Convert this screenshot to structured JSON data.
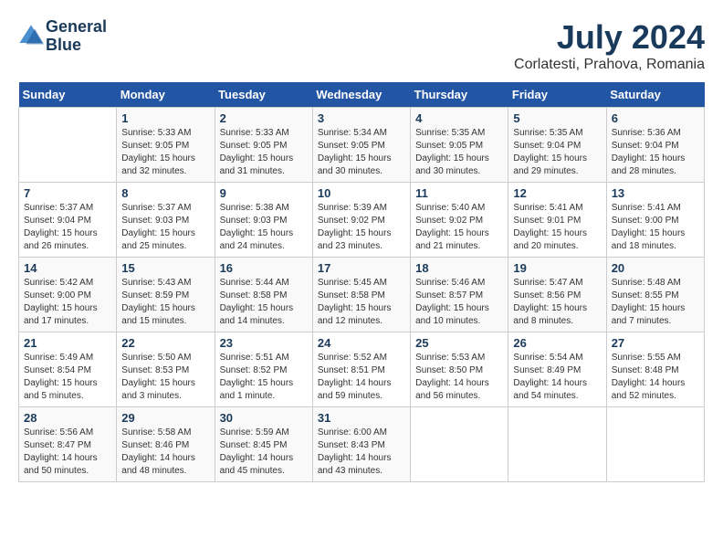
{
  "logo": {
    "line1": "General",
    "line2": "Blue"
  },
  "title": {
    "month_year": "July 2024",
    "location": "Corlatesti, Prahova, Romania"
  },
  "days_of_week": [
    "Sunday",
    "Monday",
    "Tuesday",
    "Wednesday",
    "Thursday",
    "Friday",
    "Saturday"
  ],
  "weeks": [
    [
      {
        "day": "",
        "info": ""
      },
      {
        "day": "1",
        "info": "Sunrise: 5:33 AM\nSunset: 9:05 PM\nDaylight: 15 hours\nand 32 minutes."
      },
      {
        "day": "2",
        "info": "Sunrise: 5:33 AM\nSunset: 9:05 PM\nDaylight: 15 hours\nand 31 minutes."
      },
      {
        "day": "3",
        "info": "Sunrise: 5:34 AM\nSunset: 9:05 PM\nDaylight: 15 hours\nand 30 minutes."
      },
      {
        "day": "4",
        "info": "Sunrise: 5:35 AM\nSunset: 9:05 PM\nDaylight: 15 hours\nand 30 minutes."
      },
      {
        "day": "5",
        "info": "Sunrise: 5:35 AM\nSunset: 9:04 PM\nDaylight: 15 hours\nand 29 minutes."
      },
      {
        "day": "6",
        "info": "Sunrise: 5:36 AM\nSunset: 9:04 PM\nDaylight: 15 hours\nand 28 minutes."
      }
    ],
    [
      {
        "day": "7",
        "info": "Sunrise: 5:37 AM\nSunset: 9:04 PM\nDaylight: 15 hours\nand 26 minutes."
      },
      {
        "day": "8",
        "info": "Sunrise: 5:37 AM\nSunset: 9:03 PM\nDaylight: 15 hours\nand 25 minutes."
      },
      {
        "day": "9",
        "info": "Sunrise: 5:38 AM\nSunset: 9:03 PM\nDaylight: 15 hours\nand 24 minutes."
      },
      {
        "day": "10",
        "info": "Sunrise: 5:39 AM\nSunset: 9:02 PM\nDaylight: 15 hours\nand 23 minutes."
      },
      {
        "day": "11",
        "info": "Sunrise: 5:40 AM\nSunset: 9:02 PM\nDaylight: 15 hours\nand 21 minutes."
      },
      {
        "day": "12",
        "info": "Sunrise: 5:41 AM\nSunset: 9:01 PM\nDaylight: 15 hours\nand 20 minutes."
      },
      {
        "day": "13",
        "info": "Sunrise: 5:41 AM\nSunset: 9:00 PM\nDaylight: 15 hours\nand 18 minutes."
      }
    ],
    [
      {
        "day": "14",
        "info": "Sunrise: 5:42 AM\nSunset: 9:00 PM\nDaylight: 15 hours\nand 17 minutes."
      },
      {
        "day": "15",
        "info": "Sunrise: 5:43 AM\nSunset: 8:59 PM\nDaylight: 15 hours\nand 15 minutes."
      },
      {
        "day": "16",
        "info": "Sunrise: 5:44 AM\nSunset: 8:58 PM\nDaylight: 15 hours\nand 14 minutes."
      },
      {
        "day": "17",
        "info": "Sunrise: 5:45 AM\nSunset: 8:58 PM\nDaylight: 15 hours\nand 12 minutes."
      },
      {
        "day": "18",
        "info": "Sunrise: 5:46 AM\nSunset: 8:57 PM\nDaylight: 15 hours\nand 10 minutes."
      },
      {
        "day": "19",
        "info": "Sunrise: 5:47 AM\nSunset: 8:56 PM\nDaylight: 15 hours\nand 8 minutes."
      },
      {
        "day": "20",
        "info": "Sunrise: 5:48 AM\nSunset: 8:55 PM\nDaylight: 15 hours\nand 7 minutes."
      }
    ],
    [
      {
        "day": "21",
        "info": "Sunrise: 5:49 AM\nSunset: 8:54 PM\nDaylight: 15 hours\nand 5 minutes."
      },
      {
        "day": "22",
        "info": "Sunrise: 5:50 AM\nSunset: 8:53 PM\nDaylight: 15 hours\nand 3 minutes."
      },
      {
        "day": "23",
        "info": "Sunrise: 5:51 AM\nSunset: 8:52 PM\nDaylight: 15 hours\nand 1 minute."
      },
      {
        "day": "24",
        "info": "Sunrise: 5:52 AM\nSunset: 8:51 PM\nDaylight: 14 hours\nand 59 minutes."
      },
      {
        "day": "25",
        "info": "Sunrise: 5:53 AM\nSunset: 8:50 PM\nDaylight: 14 hours\nand 56 minutes."
      },
      {
        "day": "26",
        "info": "Sunrise: 5:54 AM\nSunset: 8:49 PM\nDaylight: 14 hours\nand 54 minutes."
      },
      {
        "day": "27",
        "info": "Sunrise: 5:55 AM\nSunset: 8:48 PM\nDaylight: 14 hours\nand 52 minutes."
      }
    ],
    [
      {
        "day": "28",
        "info": "Sunrise: 5:56 AM\nSunset: 8:47 PM\nDaylight: 14 hours\nand 50 minutes."
      },
      {
        "day": "29",
        "info": "Sunrise: 5:58 AM\nSunset: 8:46 PM\nDaylight: 14 hours\nand 48 minutes."
      },
      {
        "day": "30",
        "info": "Sunrise: 5:59 AM\nSunset: 8:45 PM\nDaylight: 14 hours\nand 45 minutes."
      },
      {
        "day": "31",
        "info": "Sunrise: 6:00 AM\nSunset: 8:43 PM\nDaylight: 14 hours\nand 43 minutes."
      },
      {
        "day": "",
        "info": ""
      },
      {
        "day": "",
        "info": ""
      },
      {
        "day": "",
        "info": ""
      }
    ]
  ]
}
